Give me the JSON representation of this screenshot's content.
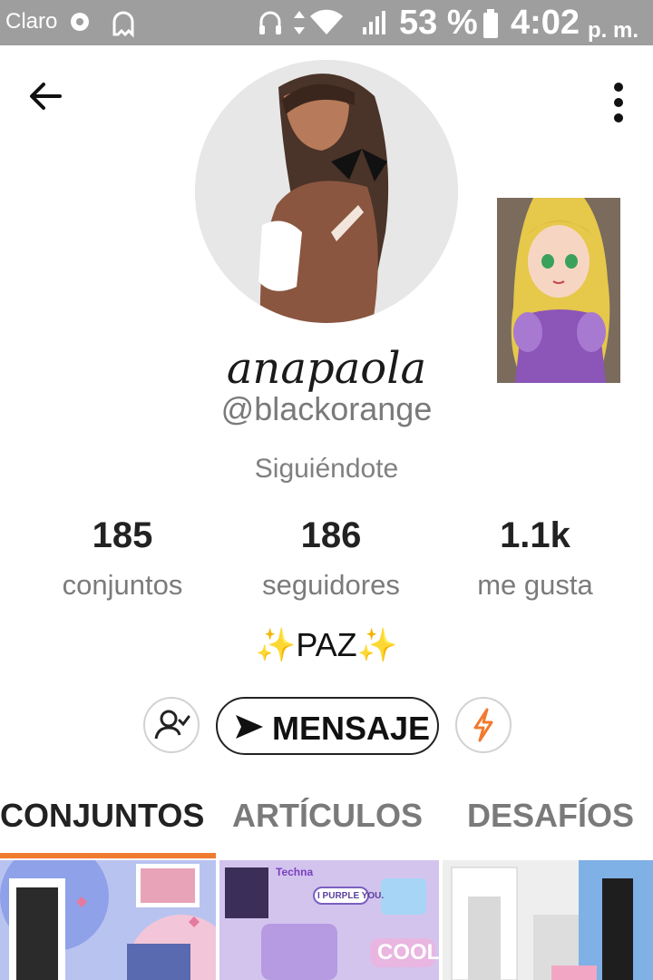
{
  "status_bar": {
    "carrier": "Claro",
    "battery_percent": "53 %",
    "time": "4:02",
    "ampm": "p. m."
  },
  "profile": {
    "display_name": "anapaola",
    "handle": "@blackorange",
    "relationship": "Siguiéndote",
    "bio": "PAZ",
    "bio_emoji": "✨"
  },
  "stats": [
    {
      "value": "185",
      "label": "conjuntos"
    },
    {
      "value": "186",
      "label": "seguidores"
    },
    {
      "value": "1.1k",
      "label": "me gusta"
    }
  ],
  "actions": {
    "message_label": "MENSAJE"
  },
  "tabs": [
    {
      "label": "CONJUNTOS",
      "active": true
    },
    {
      "label": "ARTÍCULOS",
      "active": false
    },
    {
      "label": "DESAFÍOS",
      "active": false
    }
  ],
  "thumbnails": {
    "second": {
      "title": "Techna",
      "tag": "I PURPLE YOU.",
      "word": "COOL"
    }
  },
  "colors": {
    "status_bar": "#9e9e9e",
    "accent": "#f07b30",
    "muted_text": "#7b7b7b"
  }
}
